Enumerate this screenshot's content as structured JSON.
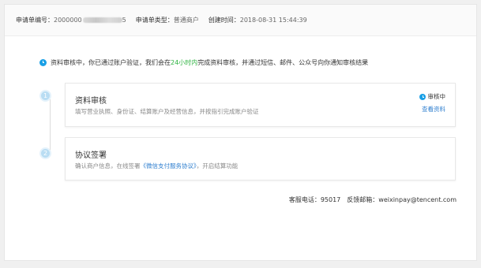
{
  "header": {
    "app_no_label": "申请单编号：",
    "app_no_value": "2000000",
    "app_no_suffix": "5",
    "type_label": "申请单类型：",
    "type_value": "普通商户",
    "created_label": "创建时间：",
    "created_value": "2018-08-31 15:44:39"
  },
  "notice": {
    "prefix": "资料审核中，你已通过账户验证，我们会在",
    "highlight": "24小时内",
    "suffix": "完成资料审核，并通过短信、邮件、公众号向你通知审核结果"
  },
  "steps": [
    {
      "number": "1",
      "title": "资料审核",
      "desc": "填写营业执照、身份证、结算账户及经营信息，并按指引完成账户验证",
      "status": "审核中",
      "action": "查看资料"
    },
    {
      "number": "2",
      "title": "协议签署",
      "desc_prefix": "确认商户信息，在线签署",
      "desc_link": "《微信支付服务协议》",
      "desc_suffix": "，开启结算功能"
    }
  ],
  "contact": {
    "phone": "客服电话：95017",
    "email": "反馈邮箱：weixinpay@tencent.com"
  },
  "colors": {
    "accent_blue": "#1aa0e6",
    "highlight_green": "#2fb342",
    "link_blue": "#2f7fcf"
  }
}
